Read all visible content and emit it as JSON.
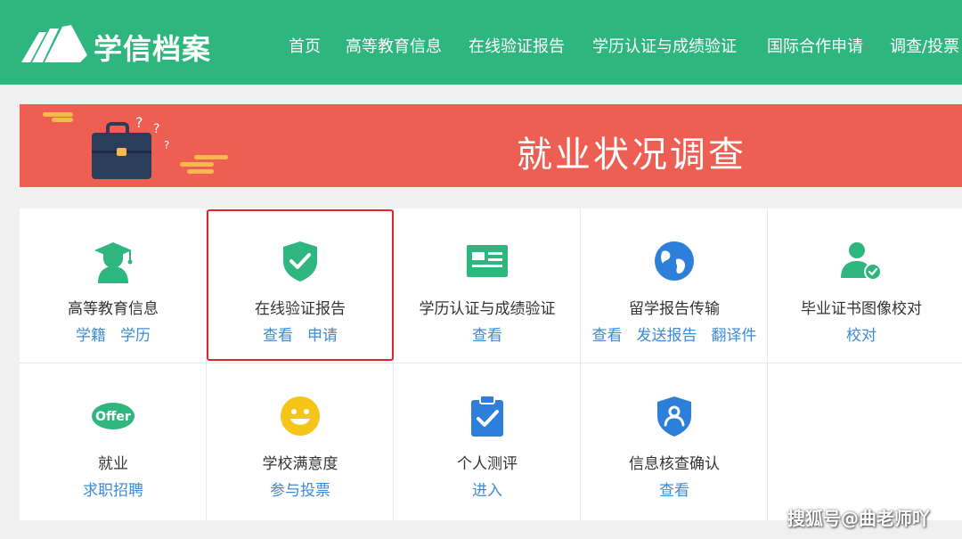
{
  "header": {
    "brand": "学信档案",
    "nav": [
      "首页",
      "高等教育信息",
      "在线验证报告",
      "学历认证与成绩验证",
      "国际合作申请",
      "调查/投票"
    ]
  },
  "banner": {
    "title": "就业状况调查"
  },
  "services": [
    {
      "title": "高等教育信息",
      "icon": "graduate-icon",
      "links": [
        "学籍",
        "学历"
      ]
    },
    {
      "title": "在线验证报告",
      "icon": "shield-check-icon",
      "links": [
        "查看",
        "申请"
      ]
    },
    {
      "title": "学历认证与成绩验证",
      "icon": "id-card-icon",
      "links": [
        "查看"
      ]
    },
    {
      "title": "留学报告传输",
      "icon": "globe-icon",
      "links": [
        "查看",
        "发送报告",
        "翻译件"
      ]
    },
    {
      "title": "毕业证书图像校对",
      "icon": "user-check-icon",
      "links": [
        "校对"
      ]
    },
    {
      "title": "就业",
      "icon": "offer-icon",
      "icon_text": "Offer",
      "links": [
        "求职招聘"
      ]
    },
    {
      "title": "学校满意度",
      "icon": "smiley-icon",
      "links": [
        "参与投票"
      ]
    },
    {
      "title": "个人测评",
      "icon": "clipboard-check-icon",
      "links": [
        "进入"
      ]
    },
    {
      "title": "信息核查确认",
      "icon": "shield-user-icon",
      "links": [
        "查看"
      ]
    }
  ],
  "watermark": "搜狐号@曲老师吖",
  "colors": {
    "header": "#2fb67e",
    "banner": "#ec5f52",
    "link": "#3d8bd4",
    "highlight": "#e0242b"
  }
}
